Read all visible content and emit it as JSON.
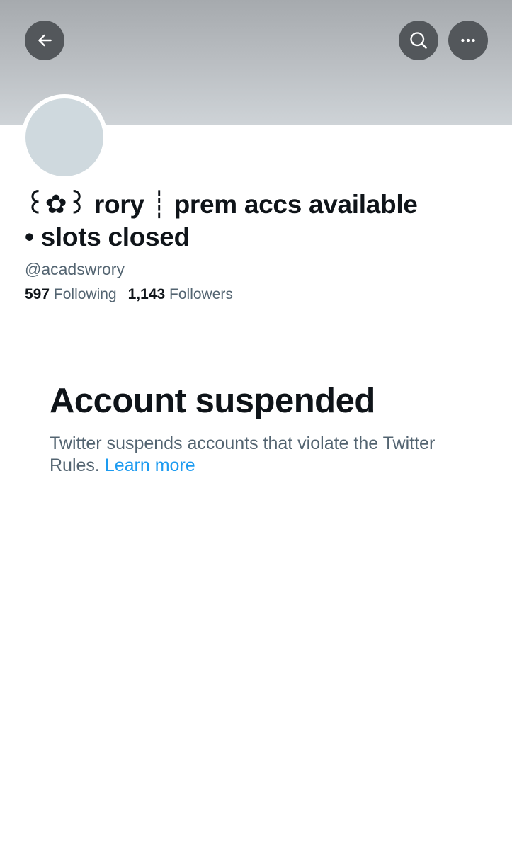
{
  "header": {
    "back_icon": "arrow-left-icon",
    "search_icon": "search-icon",
    "more_icon": "more-horizontal-icon",
    "banner_color": "#b8bcc0",
    "button_color": "#53575b"
  },
  "profile": {
    "display_name_line1": "꒰✿꒱ rory ┊ prem accs available",
    "display_name_line2": "• slots closed",
    "handle": "@acadswrory",
    "following_count": "597",
    "following_label": "Following",
    "followers_count": "1,143",
    "followers_label": "Followers",
    "avatar_color": "#cfd9de"
  },
  "suspension": {
    "title": "Account suspended",
    "message": "Twitter suspends accounts that violate the Twitter Rules.",
    "link_text": "Learn more",
    "link_color": "#1d9bf0"
  }
}
